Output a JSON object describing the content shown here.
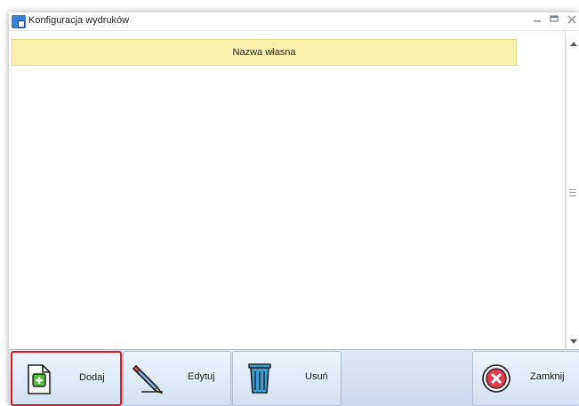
{
  "window": {
    "title": "Konfiguracja wydruków",
    "icons": {
      "app": "printer-config-app-icon",
      "minimize": "minimize-icon",
      "maximize": "maximize-icon",
      "close": "close-icon"
    }
  },
  "grid": {
    "columns": [
      "Nazwa własna"
    ],
    "rows": []
  },
  "toolbar": {
    "add_label": "Dodaj",
    "edit_label": "Edytuj",
    "delete_label": "Usuń",
    "close_label": "Zamknij",
    "icons": {
      "add": "document-add-icon",
      "edit": "pencil-icon",
      "delete": "trash-icon",
      "close": "close-circle-icon"
    }
  },
  "colors": {
    "header_background": "#fdf0ad",
    "toolbar_background": "#d3e1f3",
    "highlight_border": "#e31a1a"
  }
}
